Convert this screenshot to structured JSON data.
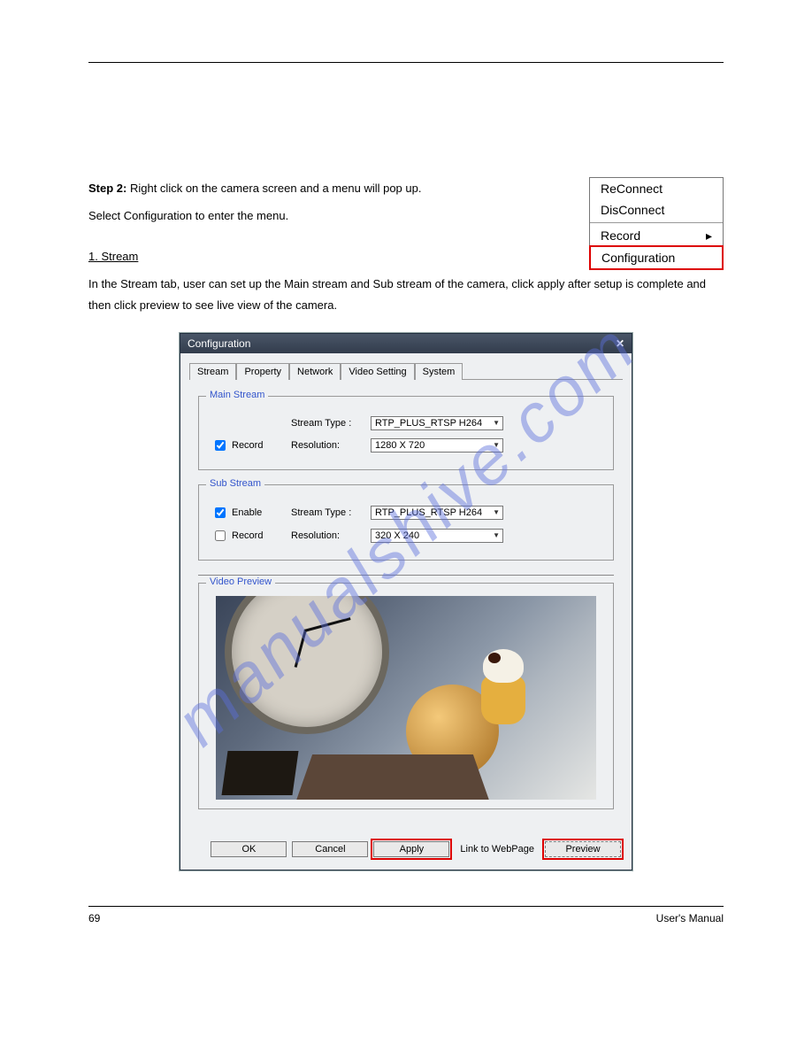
{
  "watermark": "manualshive.com",
  "document_title": "User's Manual",
  "page_number": "69",
  "context_menu": {
    "reconnect": "ReConnect",
    "disconnect": "DisConnect",
    "record": "Record",
    "configuration": "Configuration"
  },
  "body": {
    "heading_step": "Step 2:",
    "heading_text": "Right click on the camera screen and a menu will pop up.",
    "heading_text2": "Select Configuration to enter the menu.",
    "section1_title": "1. Stream",
    "section1_text": "In the Stream tab, user can set up the Main stream and Sub stream of the camera, click apply after setup is complete and then click preview to see live view of the camera."
  },
  "dialog": {
    "title": "Configuration",
    "tabs": {
      "stream": "Stream",
      "property": "Property",
      "network": "Network",
      "video_setting": "Video Setting",
      "system": "System"
    },
    "main_stream": {
      "legend": "Main Stream",
      "record_label": "Record",
      "stream_type_label": "Stream Type :",
      "stream_type_value": "RTP_PLUS_RTSP H264",
      "resolution_label": "Resolution:",
      "resolution_value": "1280 X 720"
    },
    "sub_stream": {
      "legend": "Sub Stream",
      "enable_label": "Enable",
      "record_label": "Record",
      "stream_type_label": "Stream Type :",
      "stream_type_value": "RTP_PLUS_RTSP H264",
      "resolution_label": "Resolution:",
      "resolution_value": "320 X 240"
    },
    "video_preview_legend": "Video Preview",
    "buttons": {
      "ok": "OK",
      "cancel": "Cancel",
      "apply": "Apply",
      "link": "Link to WebPage",
      "preview": "Preview"
    }
  }
}
